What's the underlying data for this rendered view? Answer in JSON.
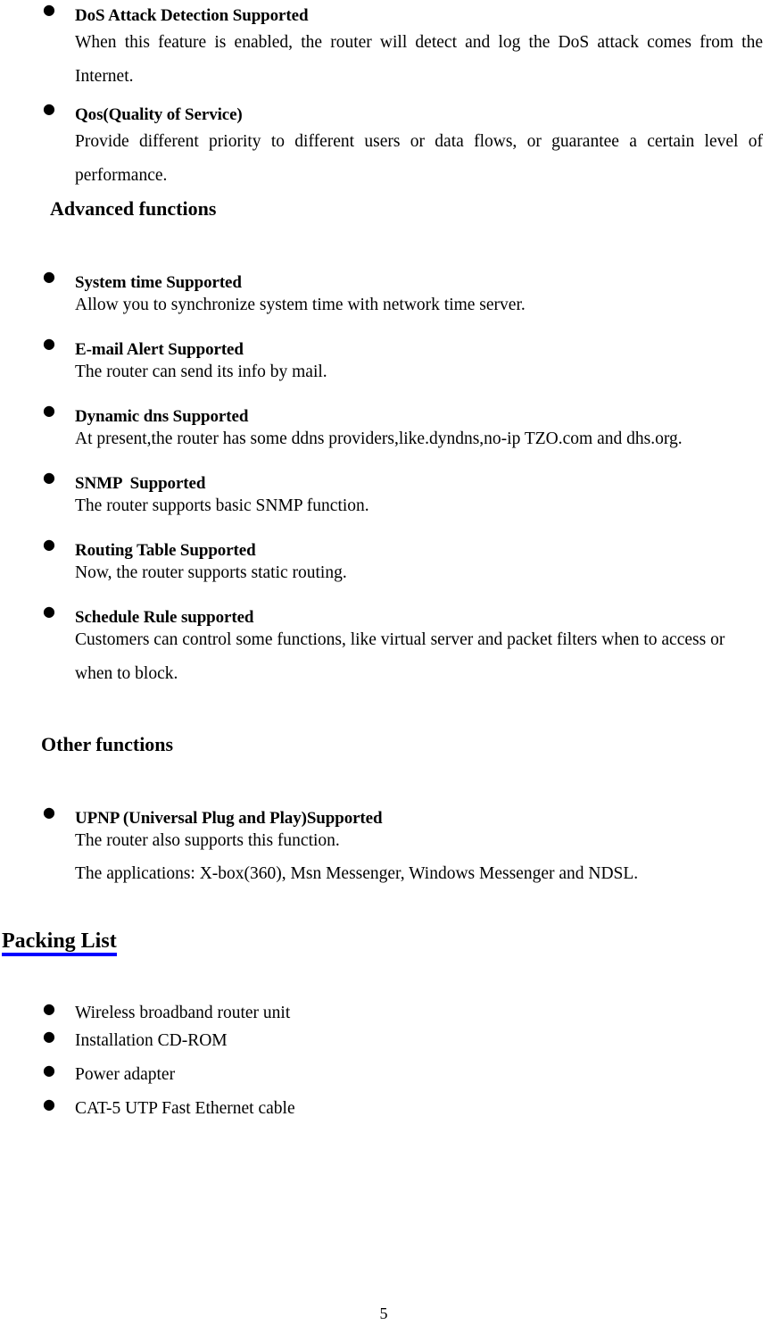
{
  "document": {
    "page_number": "5",
    "accent_underline_color": "#0000FF",
    "text_color": "#000000",
    "background_color": "#FFFFFF"
  },
  "bullet_glyph": "●",
  "continued_features": [
    {
      "heading": "DoS Attack Detection Supported",
      "body": "When this feature is enabled, the router will detect and log the DoS attack comes from the Internet."
    },
    {
      "heading": "Qos(Quality of Service)",
      "body": "Provide different priority to different users or data flows, or guarantee a certain level of performance."
    }
  ],
  "advanced_section": {
    "title": "Advanced functions",
    "items": [
      {
        "heading": "System time Supported",
        "body": "Allow you to synchronize system time with network time server."
      },
      {
        "heading": "E-mail Alert Supported",
        "body": "The router can send its info by mail."
      },
      {
        "heading": "Dynamic dns Supported",
        "body": "At present,the router has some ddns providers,like.dyndns,no-ip TZO.com and dhs.org."
      },
      {
        "heading": "SNMP  Supported",
        "body": "The router supports basic SNMP function."
      },
      {
        "heading": "Routing Table Supported",
        "body": "Now, the router supports static routing."
      },
      {
        "heading": "Schedule Rule supported",
        "body": "Customers can control some functions, like virtual server and packet filters when to access or when to block."
      }
    ]
  },
  "other_section": {
    "title": "Other functions",
    "items": [
      {
        "heading": "UPNP (Universal Plug and Play)Supported",
        "body_line_1": "The router also supports this function.",
        "body_line_2": "The applications: X-box(360), Msn Messenger, Windows Messenger and NDSL."
      }
    ]
  },
  "packing_list": {
    "title": "Packing List",
    "items": [
      "Wireless broadband router unit",
      "Installation CD-ROM",
      "Power adapter",
      "CAT-5 UTP Fast Ethernet cable"
    ]
  }
}
